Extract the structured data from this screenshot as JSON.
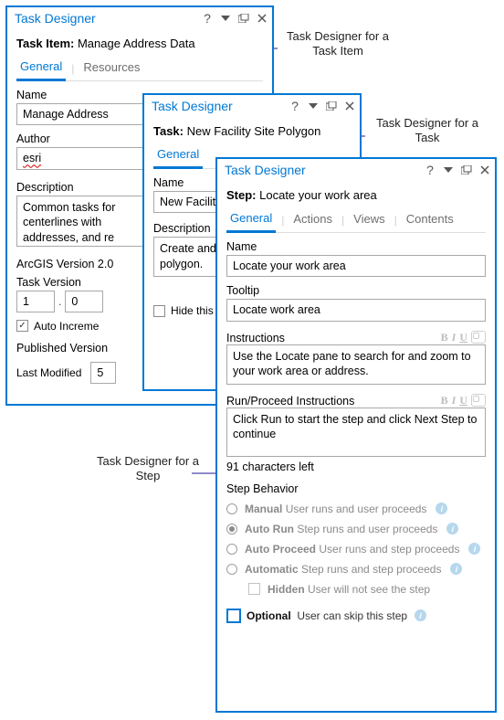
{
  "annotations": {
    "task_item": "Task Designer for a\nTask Item",
    "task": "Task Designer for a\nTask",
    "step": "Task Designer for a\nStep"
  },
  "win1": {
    "title": "Task Designer",
    "crumb_label": "Task Item:",
    "crumb_value": "Manage Address Data",
    "tabs": {
      "general": "General",
      "resources": "Resources"
    },
    "name_label": "Name",
    "name_value": "Manage Address",
    "author_label": "Author",
    "author_value": "esri",
    "description_label": "Description",
    "description_value": "Common tasks for\ncenterlines with\naddresses, and re",
    "arcgis_label": "ArcGIS Version  2.0",
    "taskver_label": "Task Version",
    "taskver_major": "1",
    "taskver_dot": ".",
    "taskver_minor": "0",
    "auto_increment": "Auto Increme",
    "published_label": "Published Version",
    "lastmod_label": "Last Modified",
    "lastmod_value": "5"
  },
  "win2": {
    "title": "Task Designer",
    "crumb_label": "Task:",
    "crumb_value": "New Facility Site Polygon",
    "tabs": {
      "general": "General"
    },
    "name_label": "Name",
    "name_value": "New Facility Site Poly",
    "description_label": "Description",
    "description_value": "Create and attribute\npolygon.",
    "hide_label": "Hide this task"
  },
  "win3": {
    "title": "Task Designer",
    "crumb_label": "Step:",
    "crumb_value": "Locate your work area",
    "tabs": {
      "general": "General",
      "actions": "Actions",
      "views": "Views",
      "contents": "Contents"
    },
    "name_label": "Name",
    "name_value": "Locate your work area",
    "tooltip_label": "Tooltip",
    "tooltip_value": "Locate work area",
    "instr_label": "Instructions",
    "instr_value": "Use the Locate pane to search for and zoom to your work area or address.",
    "run_label": "Run/Proceed Instructions",
    "run_value": "Click Run to start the step and click Next Step to continue",
    "chars_left": "91 characters left",
    "behavior_label": "Step Behavior",
    "opts": {
      "manual_b": "Manual",
      "manual_d": "User runs and user proceeds",
      "autorun_b": "Auto Run",
      "autorun_d": "Step runs and user proceeds",
      "autoproceed_b": "Auto Proceed",
      "autoproceed_d": "User runs and step proceeds",
      "automatic_b": "Automatic",
      "automatic_d": "Step runs and step proceeds",
      "hidden_b": "Hidden",
      "hidden_d": "User will not see the step"
    },
    "optional_b": "Optional",
    "optional_d": "User can skip this step"
  }
}
